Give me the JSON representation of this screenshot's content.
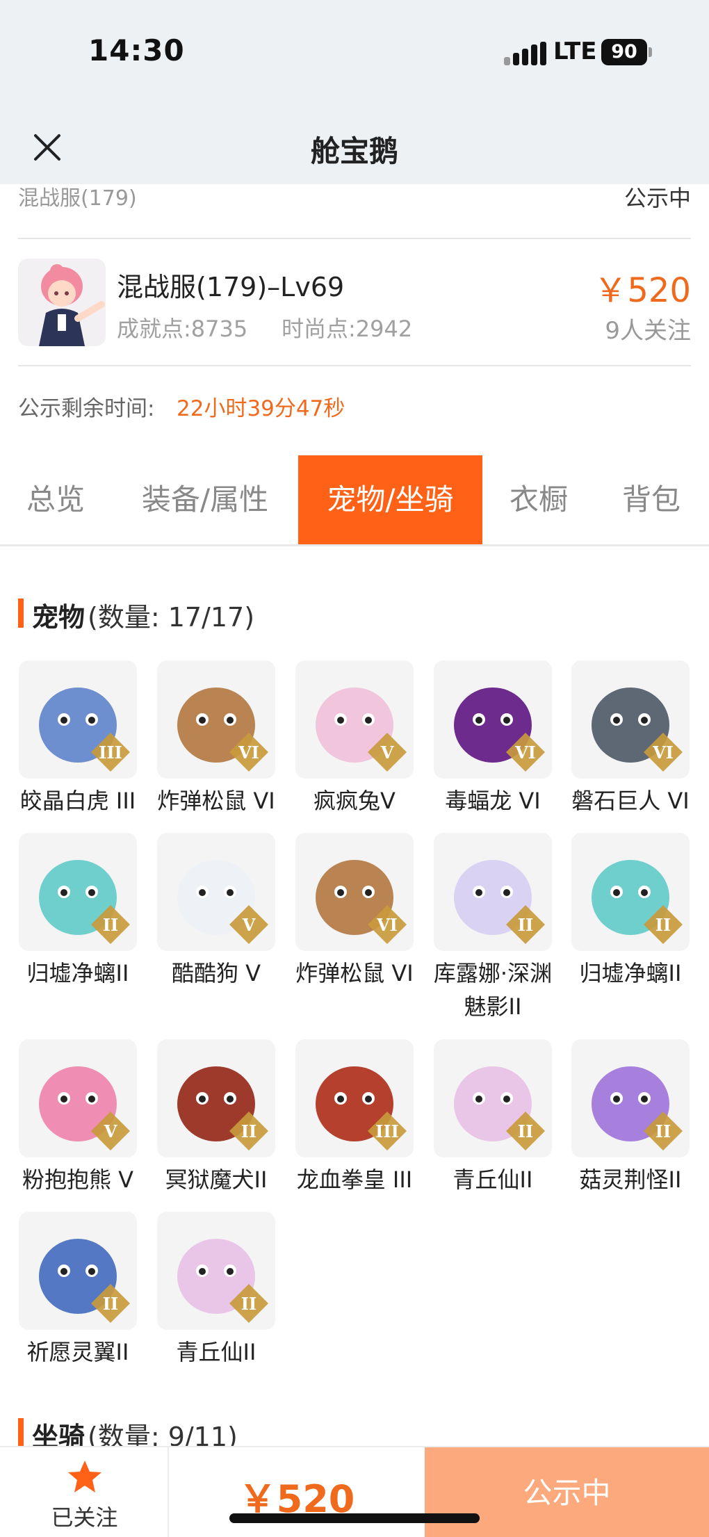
{
  "status_bar": {
    "time": "14:30",
    "network": "LTE",
    "battery": "90"
  },
  "nav": {
    "title": "舱宝鹅"
  },
  "account": {
    "server_partial": "混战服(179)",
    "status_partial": "公示中",
    "name": "混战服(179)–Lv69",
    "achievement": "成就点:8735",
    "fashion": "时尚点:2942",
    "price": "￥520",
    "followers": "9人关注",
    "remaining_label": "公示剩余时间:",
    "remaining_value": "22小时39分47秒"
  },
  "tabs": [
    {
      "label": "总览",
      "active": false
    },
    {
      "label": "装备/属性",
      "active": false
    },
    {
      "label": "宠物/坐骑",
      "active": true
    },
    {
      "label": "衣橱",
      "active": false
    },
    {
      "label": "背包",
      "active": false
    }
  ],
  "pets_section": {
    "title": "宠物",
    "count": "(数量: 17/17)"
  },
  "pets": [
    {
      "name": "皎晶白虎 III",
      "rank": "III",
      "color": "#6d8fcf"
    },
    {
      "name": "炸弹松鼠 VI",
      "rank": "VI",
      "color": "#b98352"
    },
    {
      "name": "疯疯兔V",
      "rank": "V",
      "color": "#f1c6dd"
    },
    {
      "name": "毒蝠龙 VI",
      "rank": "VI",
      "color": "#6d2c8d"
    },
    {
      "name": "磐石巨人 VI",
      "rank": "VI",
      "color": "#5e6874"
    },
    {
      "name": "归墟净螭II",
      "rank": "II",
      "color": "#6fcfcc"
    },
    {
      "name": "酷酷狗 V",
      "rank": "V",
      "color": "#eef1f6"
    },
    {
      "name": "炸弹松鼠 VI",
      "rank": "VI",
      "color": "#b98352"
    },
    {
      "name": "库露娜·深渊魅影II",
      "rank": "II",
      "color": "#d9d2f2"
    },
    {
      "name": "归墟净螭II",
      "rank": "II",
      "color": "#6fcfcc"
    },
    {
      "name": "粉抱抱熊 V",
      "rank": "V",
      "color": "#ef8eb2"
    },
    {
      "name": "冥狱魔犬II",
      "rank": "II",
      "color": "#9e3a2c"
    },
    {
      "name": "龙血拳皇 III",
      "rank": "III",
      "color": "#b5402e"
    },
    {
      "name": "青丘仙II",
      "rank": "II",
      "color": "#e9c6e8"
    },
    {
      "name": "菇灵荆怪II",
      "rank": "II",
      "color": "#a77fdc"
    },
    {
      "name": "祈愿灵翼II",
      "rank": "II",
      "color": "#5478c4"
    },
    {
      "name": "青丘仙II",
      "rank": "II",
      "color": "#e9c6e8"
    }
  ],
  "mounts_section": {
    "title": "坐骑",
    "count": "(数量: 9/11)"
  },
  "bottom": {
    "follow_label": "已关注",
    "price": "￥520",
    "action": "公示中"
  },
  "colors": {
    "accent": "#ff6216",
    "price": "#f06a1e",
    "action_bg": "#fcaa7d"
  }
}
